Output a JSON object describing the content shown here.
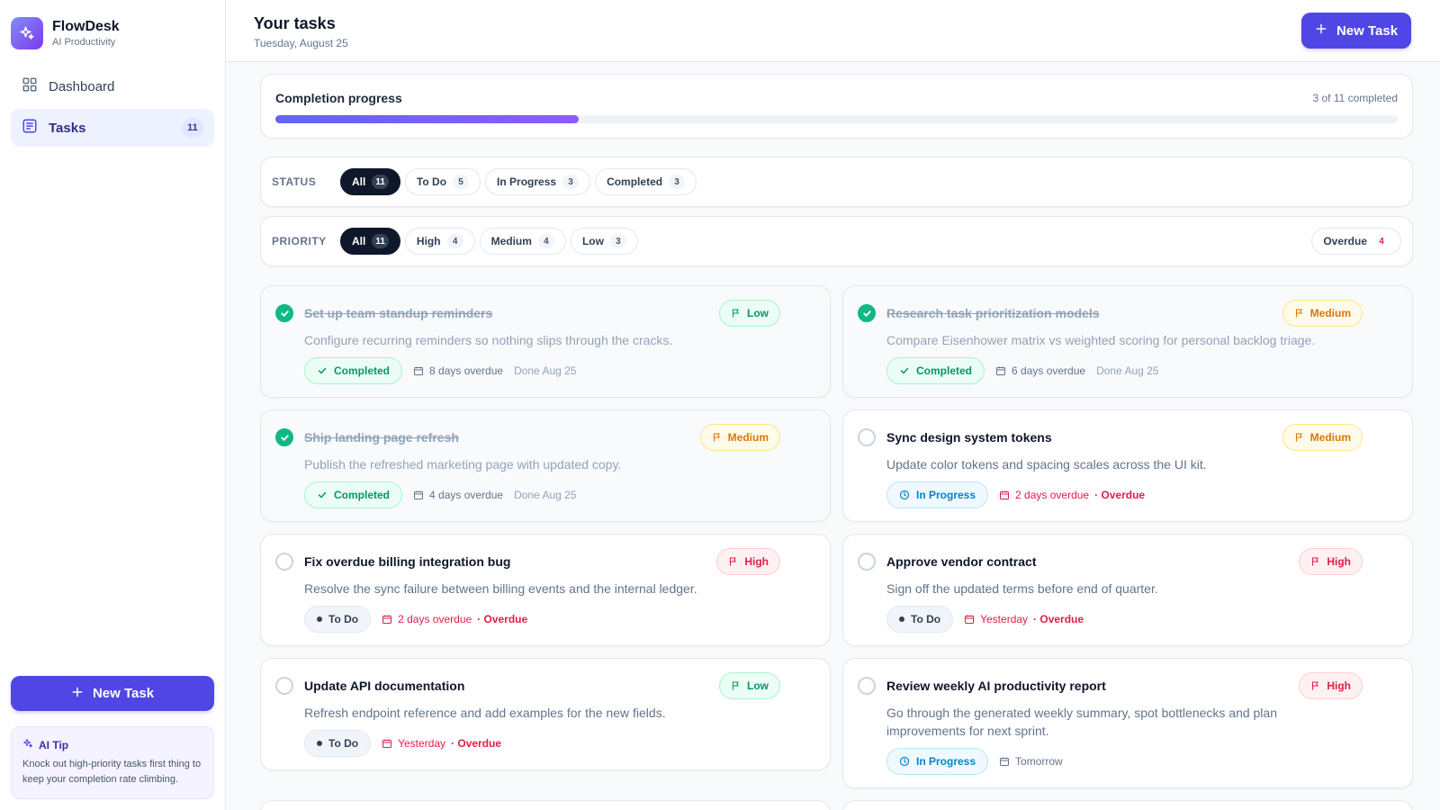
{
  "app": {
    "name": "FlowDesk",
    "tagline": "AI Productivity"
  },
  "sidebar": {
    "nav": [
      {
        "label": "Dashboard",
        "icon": "grid-icon",
        "active": false
      },
      {
        "label": "Tasks",
        "icon": "list-icon",
        "active": true,
        "count": "11"
      }
    ],
    "new_task_label": "New Task",
    "tip": {
      "title": "AI Tip",
      "text": "Knock out high-priority tasks first thing to keep your completion rate climbing."
    }
  },
  "header": {
    "title": "Your tasks",
    "date": "Tuesday, August 25",
    "new_task_label": "New Task"
  },
  "progress": {
    "title": "Completion progress",
    "count_text": "3 of 11 completed",
    "completed": 3,
    "total": 11,
    "fraction": 0.27
  },
  "filters": {
    "status": {
      "label": "STATUS",
      "options": [
        {
          "label": "All",
          "count": "11",
          "active": true
        },
        {
          "label": "To Do",
          "count": "5",
          "active": false
        },
        {
          "label": "In Progress",
          "count": "3",
          "active": false
        },
        {
          "label": "Completed",
          "count": "3",
          "active": false
        }
      ]
    },
    "priority": {
      "label": "PRIORITY",
      "options": [
        {
          "label": "All",
          "count": "11",
          "active": true
        },
        {
          "label": "High",
          "count": "4",
          "active": false
        },
        {
          "label": "Medium",
          "count": "4",
          "active": false
        },
        {
          "label": "Low",
          "count": "3",
          "active": false
        }
      ],
      "overdue": {
        "label": "Overdue",
        "count": "4"
      }
    }
  },
  "tasks": [
    {
      "title": "Set up team standup reminders",
      "description": "Configure recurring reminders so nothing slips through the cracks.",
      "priority": "Low",
      "status": "Completed",
      "due": "8 days overdue",
      "done": "Done Aug 25"
    },
    {
      "title": "Research task prioritization models",
      "description": "Compare Eisenhower matrix vs weighted scoring for personal backlog triage.",
      "priority": "Medium",
      "status": "Completed",
      "due": "6 days overdue",
      "done": "Done Aug 25"
    },
    {
      "title": "Ship landing page refresh",
      "description": "Publish the refreshed marketing page with updated copy.",
      "priority": "Medium",
      "status": "Completed",
      "due": "4 days overdue",
      "done": "Done Aug 25"
    },
    {
      "title": "Sync design system tokens",
      "description": "Update color tokens and spacing scales across the UI kit.",
      "priority": "Medium",
      "status": "In Progress",
      "due": "2 days overdue",
      "overdue_tag": "· Overdue"
    },
    {
      "title": "Fix overdue billing integration bug",
      "description": "Resolve the sync failure between billing events and the internal ledger.",
      "priority": "High",
      "status": "To Do",
      "due": "2 days overdue",
      "overdue_tag": "· Overdue"
    },
    {
      "title": "Approve vendor contract",
      "description": "Sign off the updated terms before end of quarter.",
      "priority": "High",
      "status": "To Do",
      "due": "Yesterday",
      "overdue_tag": "· Overdue"
    },
    {
      "title": "Update API documentation",
      "description": "Refresh endpoint reference and add examples for the new fields.",
      "priority": "Low",
      "status": "To Do",
      "due": "Yesterday",
      "overdue_tag": "· Overdue"
    },
    {
      "title": "Review weekly AI productivity report",
      "description": "Go through the generated weekly summary, spot bottlenecks and plan improvements for next sprint.",
      "priority": "High",
      "status": "In Progress",
      "due": "Tomorrow"
    }
  ],
  "colors": {
    "accent": "#4f46e5",
    "success": "#10b981",
    "danger": "#e11d48",
    "warning": "#d97706",
    "info": "#0284c7"
  }
}
